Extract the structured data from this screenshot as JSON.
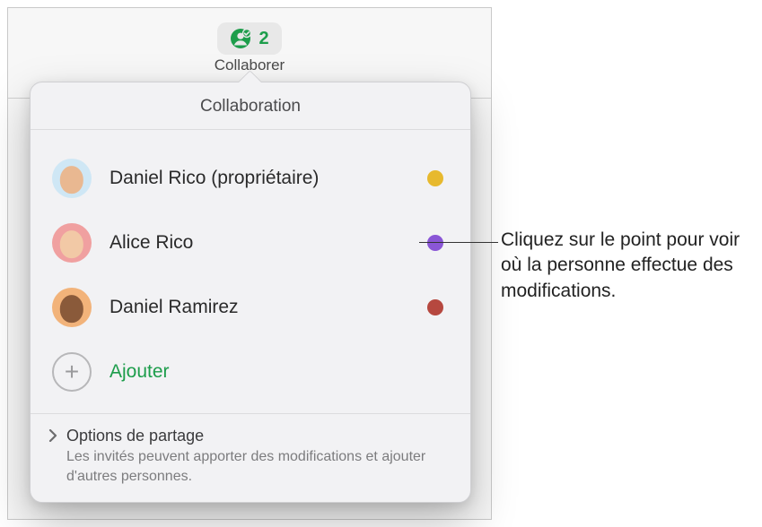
{
  "toolbar": {
    "count": "2",
    "label": "Collaborer",
    "icon_color": "#1d9d4b"
  },
  "popover": {
    "title": "Collaboration",
    "people": [
      {
        "name": "Daniel Rico (propriétaire)",
        "dot_color": "#e7b92e",
        "avatar_bg": "#cfe7f5",
        "face": "#e9b891"
      },
      {
        "name": "Alice Rico",
        "dot_color": "#8a56d6",
        "avatar_bg": "#f0a0a0",
        "face": "#f2c9a6"
      },
      {
        "name": "Daniel Ramirez",
        "dot_color": "#b6483f",
        "avatar_bg": "#f2b37a",
        "face": "#8a5a3a"
      }
    ],
    "add_label": "Ajouter",
    "footer": {
      "title": "Options de partage",
      "subtitle": "Les invités peuvent apporter des modifications et ajouter d'autres personnes."
    }
  },
  "callout": "Cliquez sur le point pour voir où la personne effectue des modifications."
}
